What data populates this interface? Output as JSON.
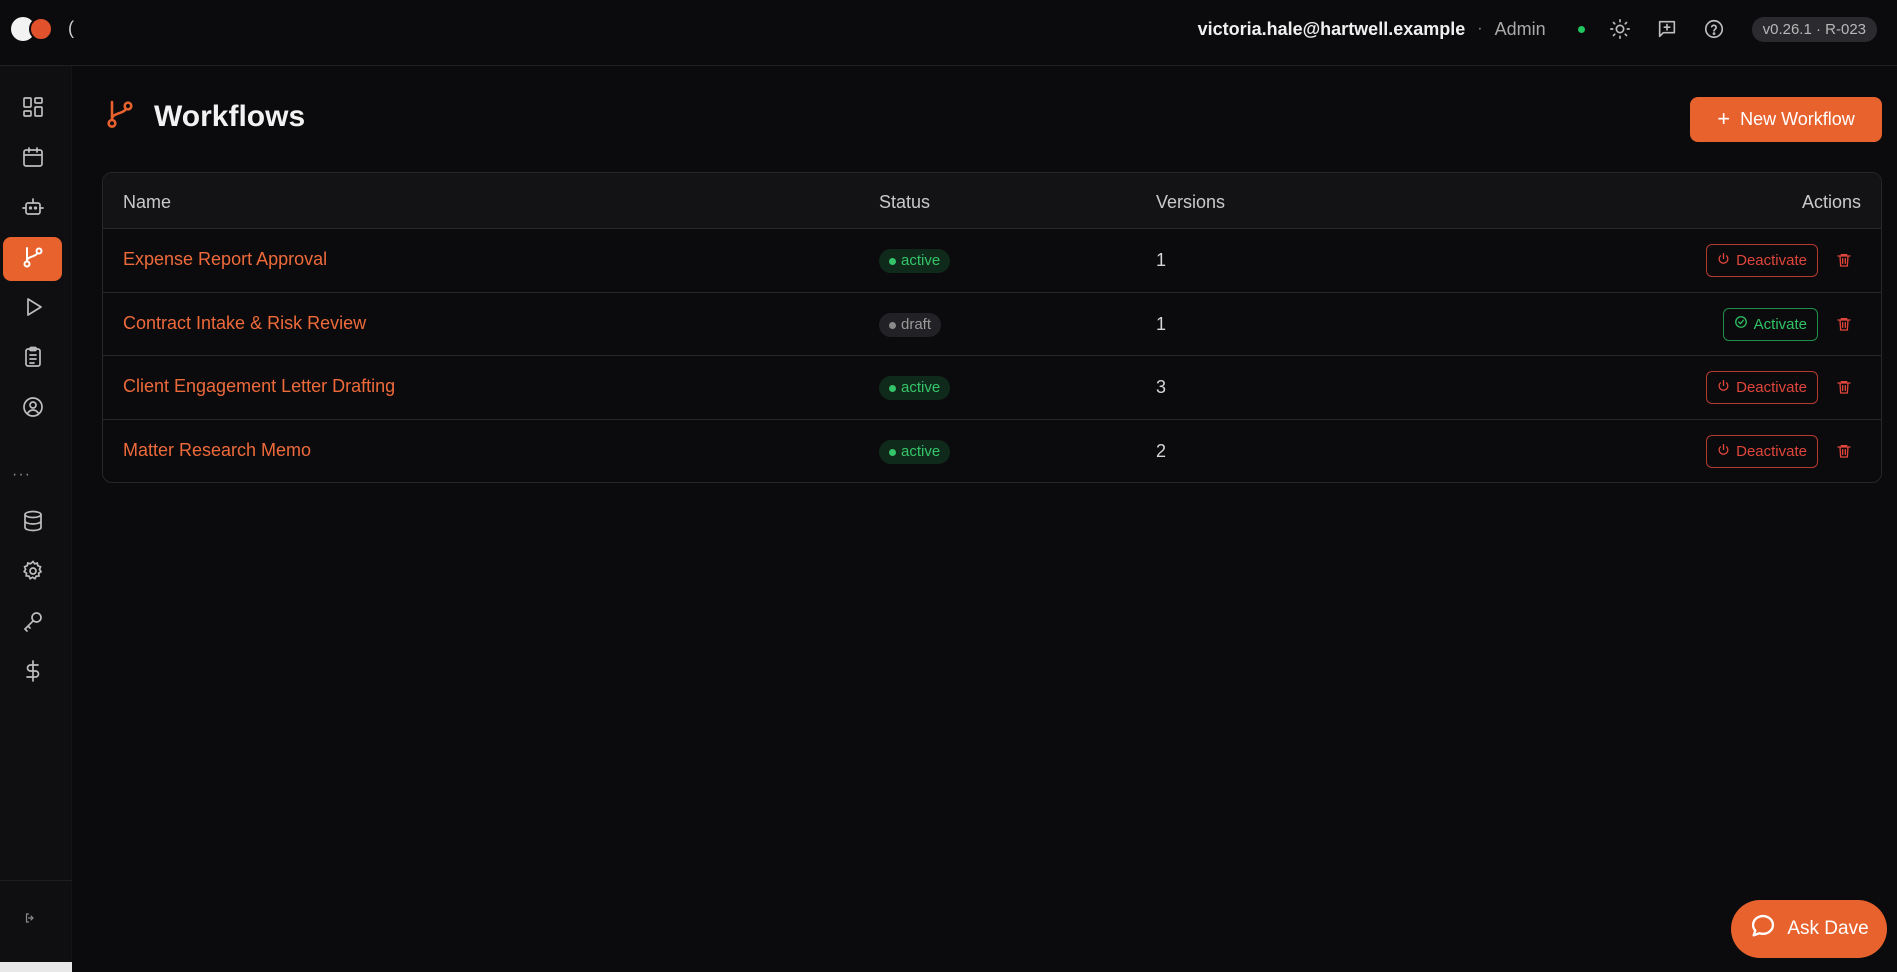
{
  "topbar": {
    "logo_suffix": "(",
    "user_email": "victoria.hale@hartwell.example",
    "separator": "·",
    "role": "Admin",
    "version": "v0.26.1 · R-023"
  },
  "sidebar": {
    "items": [
      {
        "icon": "dashboard-icon"
      },
      {
        "icon": "calendar-icon"
      },
      {
        "icon": "robot-icon"
      },
      {
        "icon": "workflow-icon",
        "active": true
      },
      {
        "icon": "play-icon"
      },
      {
        "icon": "clipboard-icon"
      },
      {
        "icon": "user-circle-icon"
      },
      {
        "icon": "database-icon"
      },
      {
        "icon": "gear-icon"
      },
      {
        "icon": "key-icon"
      },
      {
        "icon": "dollar-icon"
      }
    ],
    "more": "···"
  },
  "page": {
    "title": "Workflows",
    "new_button": "New Workflow"
  },
  "table": {
    "headers": {
      "name": "Name",
      "status": "Status",
      "versions": "Versions",
      "actions": "Actions"
    },
    "rows": [
      {
        "name": "Expense Report Approval",
        "status": "active",
        "versions": "1",
        "action": "Deactivate"
      },
      {
        "name": "Contract Intake & Risk Review",
        "status": "draft",
        "versions": "1",
        "action": "Activate"
      },
      {
        "name": "Client Engagement Letter Drafting",
        "status": "active",
        "versions": "3",
        "action": "Deactivate"
      },
      {
        "name": "Matter Research Memo",
        "status": "active",
        "versions": "2",
        "action": "Deactivate"
      }
    ]
  },
  "assistant": {
    "label": "Ask Dave"
  },
  "colors": {
    "accent": "#e8622e",
    "success": "#35c46a",
    "danger": "#e0463b"
  }
}
